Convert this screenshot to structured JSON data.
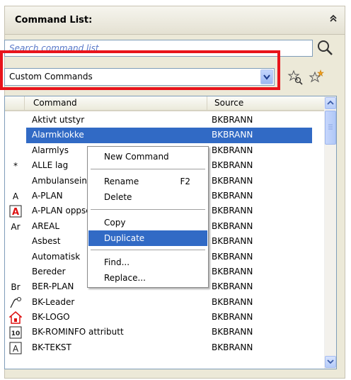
{
  "panel": {
    "title": "Command List:",
    "collapse_icon": "chevron-up-double"
  },
  "search": {
    "placeholder": "Search command list",
    "icon": "magnifier-icon"
  },
  "filter": {
    "selected": "Custom Commands",
    "highlight_color": "#e8141c"
  },
  "list": {
    "columns": [
      "Command",
      "Source"
    ],
    "rows": [
      {
        "icon": "",
        "command": "Aktivt utstyr",
        "source": "BKBRANN"
      },
      {
        "icon": "",
        "command": "Alarmklokke",
        "source": "BKBRANN",
        "selected": true
      },
      {
        "icon": "",
        "command": "Alarmlys",
        "source": "BKBRANN"
      },
      {
        "icon": "*",
        "command": "ALLE lag",
        "source": "BKBRANN"
      },
      {
        "icon": "",
        "command": "Ambulanseinnkjøring",
        "source": "BKBRANN"
      },
      {
        "icon": "A",
        "command": "A-PLAN",
        "source": "BKBRANN"
      },
      {
        "icon": "A-red",
        "command": "A-PLAN oppsett",
        "source": "BKBRANN"
      },
      {
        "icon": "Ar",
        "command": "AREAL",
        "source": "BKBRANN"
      },
      {
        "icon": "",
        "command": "Asbest",
        "source": "BKBRANN"
      },
      {
        "icon": "",
        "command": "Automatisk",
        "source": "BKBRANN"
      },
      {
        "icon": "",
        "command": "Bereder",
        "source": "BKBRANN"
      },
      {
        "icon": "Br",
        "command": "BER-PLAN",
        "source": "BKBRANN"
      },
      {
        "icon": "leader",
        "command": "BK-Leader",
        "source": "BKBRANN"
      },
      {
        "icon": "house-red",
        "command": "BK-LOGO",
        "source": "BKBRANN"
      },
      {
        "icon": "box-10",
        "command": "BK-ROMINFO attributt",
        "source": "BKBRANN"
      },
      {
        "icon": "box-A",
        "command": "BK-TEKST",
        "source": "BKBRANN"
      }
    ]
  },
  "context_menu": {
    "new_command": "New Command",
    "rename": "Rename",
    "rename_shortcut": "F2",
    "delete": "Delete",
    "copy": "Copy",
    "duplicate": "Duplicate",
    "find": "Find...",
    "replace": "Replace..."
  }
}
